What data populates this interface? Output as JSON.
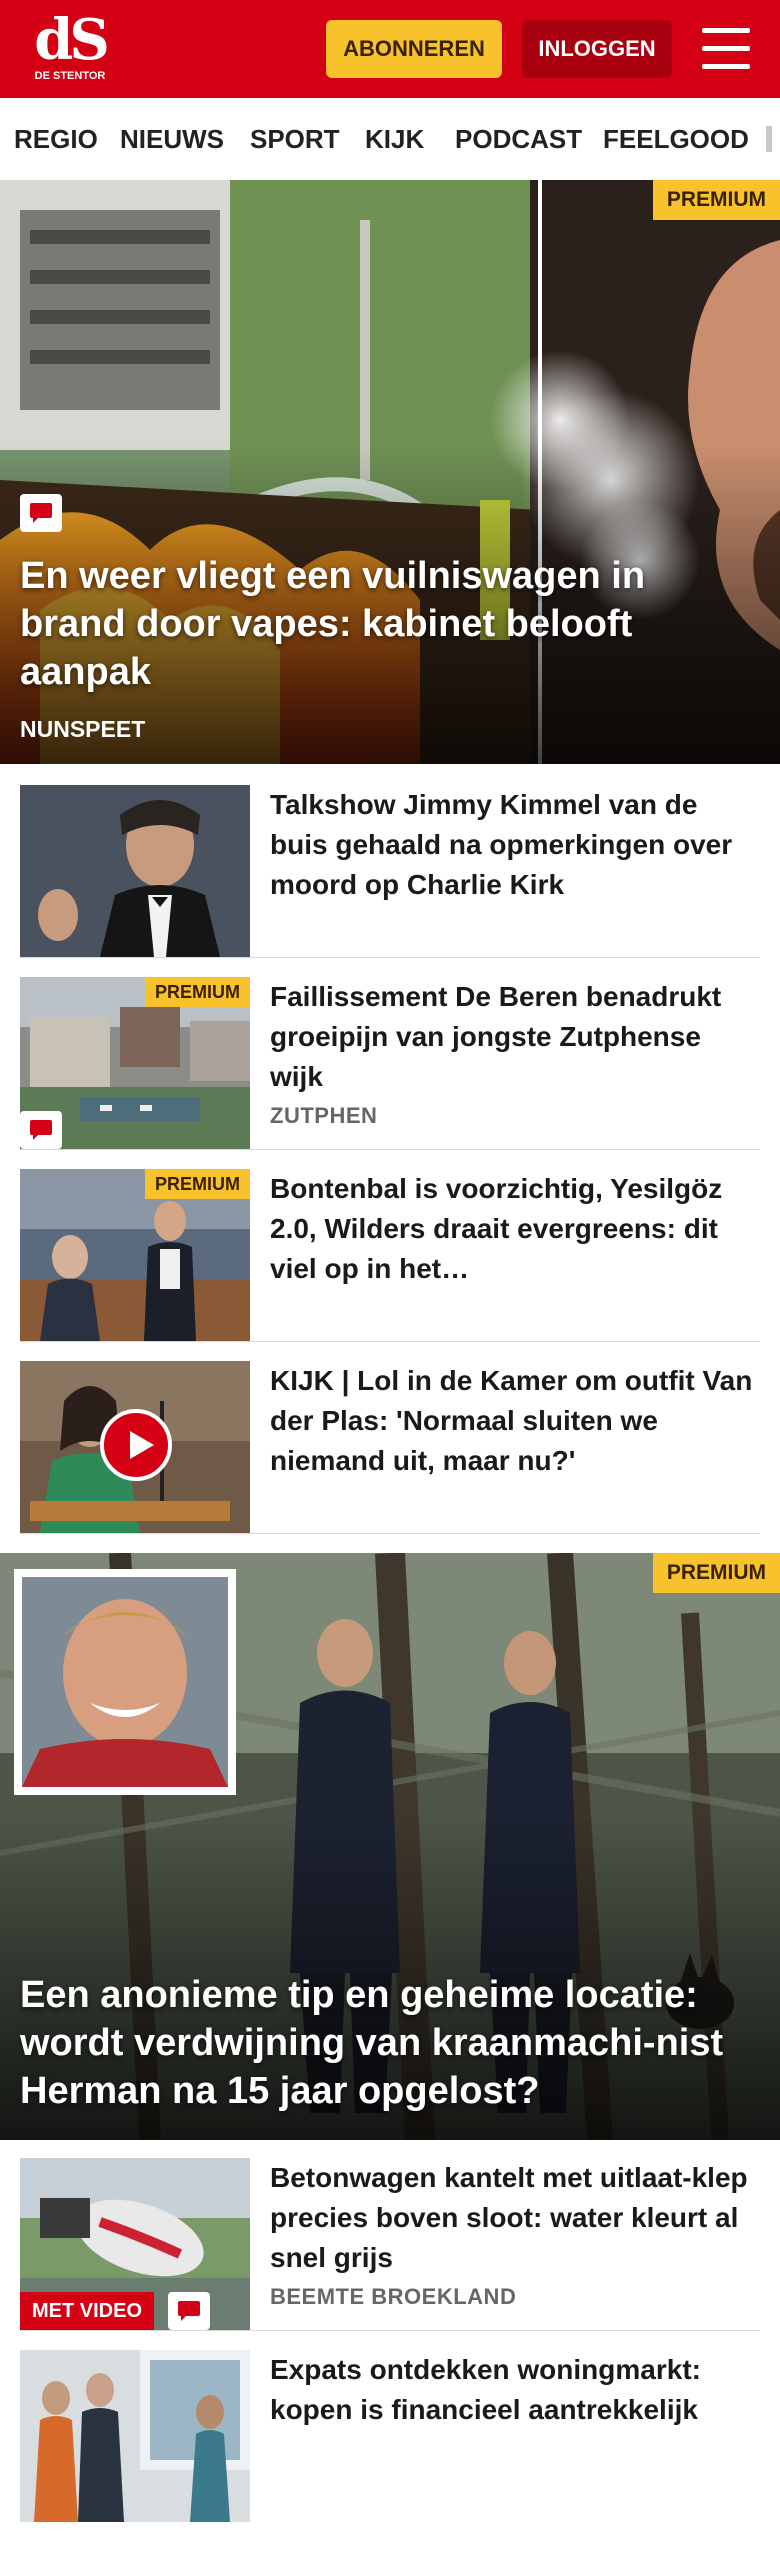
{
  "header": {
    "logo_mark": "dS",
    "logo_sub": "DE STENTOR",
    "subscribe_label": "ABONNEREN",
    "login_label": "INLOGGEN"
  },
  "nav": {
    "items": [
      "REGIO",
      "NIEUWS",
      "SPORT",
      "KIJK",
      "PODCAST",
      "FEELGOOD"
    ]
  },
  "colors": {
    "brand_red": "#d40014",
    "premium_yellow": "#f7c22b",
    "login_dark_red": "#a8000f"
  },
  "hero1": {
    "badge": "PREMIUM",
    "title": "En weer vliegt een vuilniswagen in brand door vapes: kabinet belooft aanpak",
    "location": "NUNSPEET",
    "has_comments": true
  },
  "articles": [
    {
      "title": "Talkshow Jimmy Kimmel van de buis gehaald na opmerkingen over moord op Charlie Kirk",
      "location": "",
      "premium": ""
    },
    {
      "title": "Faillissement De Beren benadrukt groeipijn van jongste Zutphense wijk",
      "location": "ZUTPHEN",
      "premium": "PREMIUM"
    },
    {
      "title": "Bontenbal is voorzichtig, Yesilgöz 2.0, Wilders draait evergreens: dit viel op in het…",
      "location": "",
      "premium": "PREMIUM"
    },
    {
      "title": "KIJK | Lol in de Kamer om outfit Van der Plas: 'Normaal sluiten we niemand uit, maar nu?'",
      "location": "",
      "premium": ""
    }
  ],
  "hero2": {
    "badge": "PREMIUM",
    "title": "Een anonieme tip en geheime locatie: wordt verdwijning van kraanmachi-nist Herman na 15 jaar opgelost?"
  },
  "articles2": [
    {
      "title": "Betonwagen kantelt met uitlaat-klep precies boven sloot: water kleurt al snel grijs",
      "location": "BEEMTE BROEKLAND",
      "badge": "MET VIDEO"
    },
    {
      "title": "Expats ontdekken woningmarkt: kopen is financieel aantrekkelijk",
      "location": "",
      "badge": ""
    }
  ],
  "icons": [
    "hamburger-menu-icon",
    "comment-icon",
    "play-icon"
  ]
}
